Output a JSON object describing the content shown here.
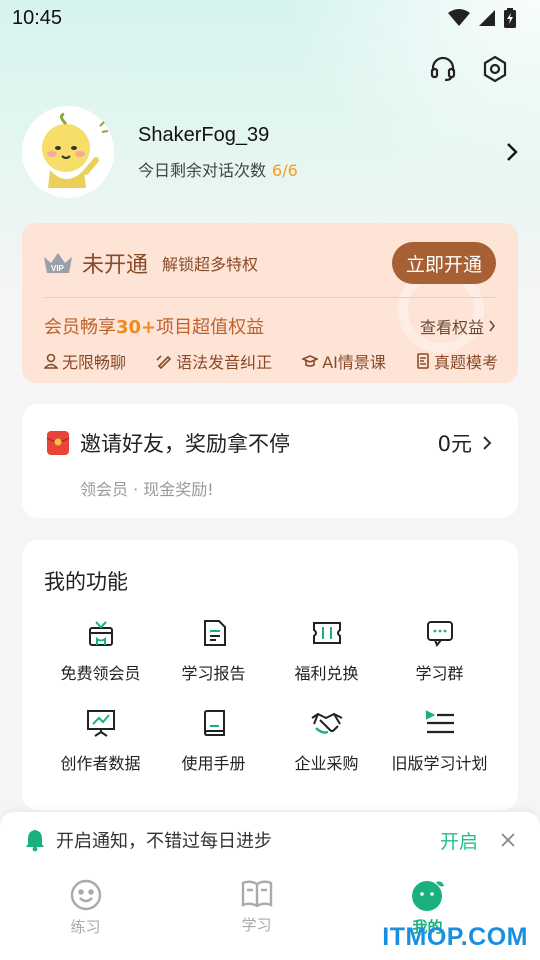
{
  "status_bar": {
    "time": "10:45"
  },
  "profile": {
    "username": "ShakerFog_39",
    "chat_label": "今日剩余对话次数",
    "chat_count": "6/6"
  },
  "vip": {
    "title": "未开通",
    "subtitle": "解锁超多特权",
    "button": "立即开通",
    "headline_pre": "会员畅享",
    "headline_highlight": "30+",
    "headline_post": "项目超值权益",
    "link": "查看权益",
    "perks": [
      "无限畅聊",
      "语法发音纠正",
      "AI情景课",
      "真题模考"
    ]
  },
  "invite": {
    "title": "邀请好友，奖励拿不停",
    "amount": "0元",
    "subtitle": "领会员 · 现金奖励!"
  },
  "functions": {
    "title": "我的功能",
    "items": [
      {
        "label": "免费领会员",
        "icon": "gift-icon"
      },
      {
        "label": "学习报告",
        "icon": "report-icon"
      },
      {
        "label": "福利兑换",
        "icon": "ticket-icon"
      },
      {
        "label": "学习群",
        "icon": "chat-group-icon"
      },
      {
        "label": "创作者数据",
        "icon": "chart-board-icon"
      },
      {
        "label": "使用手册",
        "icon": "book-icon"
      },
      {
        "label": "企业采购",
        "icon": "handshake-icon"
      },
      {
        "label": "旧版学习计划",
        "icon": "plan-list-icon"
      }
    ]
  },
  "notify": {
    "text": "开启通知，不错过每日进步",
    "action": "开启"
  },
  "tabs": [
    {
      "label": "练习",
      "icon": "smile-icon",
      "active": false
    },
    {
      "label": "学习",
      "icon": "open-book-icon",
      "active": false
    },
    {
      "label": "我的",
      "icon": "profile-face-icon",
      "active": true
    }
  ],
  "watermark": "ITMOP.COM",
  "colors": {
    "accent_green": "#1ab07f",
    "vip_bg": "#fde4d6",
    "vip_button": "#a66033",
    "count_orange": "#f0a020"
  }
}
